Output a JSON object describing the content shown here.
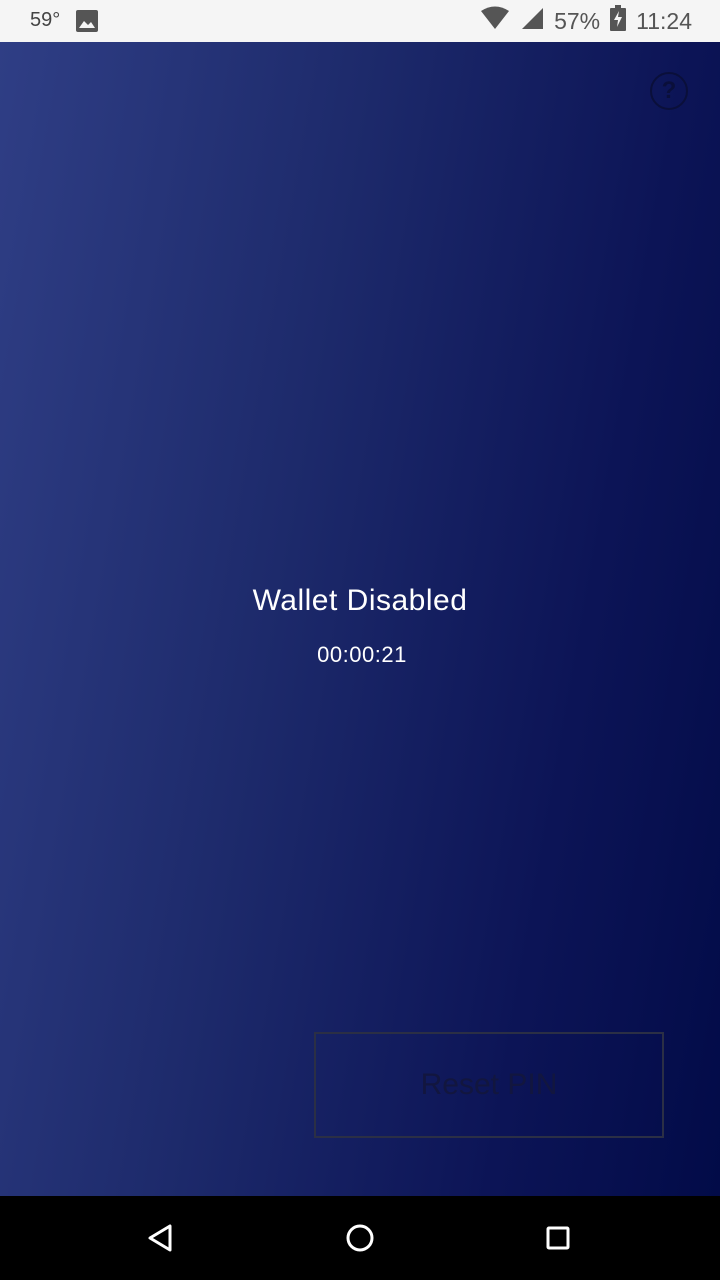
{
  "status_bar": {
    "temperature": "59°",
    "battery_percent": "57%",
    "time": "11:24",
    "icons": [
      "image-icon",
      "wifi-icon",
      "signal-icon",
      "battery-charging-icon"
    ]
  },
  "header": {
    "help_icon": "question-circle-icon",
    "help_label": "?"
  },
  "main": {
    "title": "Wallet Disabled",
    "timer": "00:00:21"
  },
  "actions": {
    "reset_pin_label": "Reset PIN"
  },
  "nav_bar": {
    "icons": [
      "back-icon",
      "home-icon",
      "recents-icon"
    ]
  },
  "colors": {
    "gradient_start": "#2f3e85",
    "gradient_end": "#020b48",
    "text": "#ffffff",
    "disabled_button_text": "#12163f"
  }
}
